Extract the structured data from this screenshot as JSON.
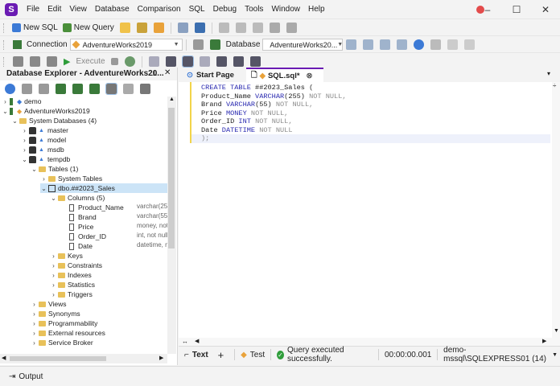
{
  "menu": [
    "File",
    "Edit",
    "View",
    "Database",
    "Comparison",
    "SQL",
    "Debug",
    "Tools",
    "Window",
    "Help"
  ],
  "app_logo": "S",
  "window_controls": {
    "minimize": "–",
    "maximize": "☐",
    "close": "✕"
  },
  "toolbar1": {
    "new_sql": "New SQL",
    "new_query": "New Query"
  },
  "toolbar2": {
    "connection_label": "Connection",
    "connection_value": "AdventureWorks2019",
    "database_label": "Database",
    "database_value": "AdventureWorks20..."
  },
  "toolbar3": {
    "execute": "Execute"
  },
  "explorer": {
    "title": "Database Explorer - AdventureWorks20...",
    "tree": [
      {
        "label": "demo",
        "depth": 0,
        "arrow": "›",
        "icon": "server-icon"
      },
      {
        "label": "AdventureWorks2019",
        "depth": 0,
        "arrow": "⌄",
        "icon": "server-icon"
      },
      {
        "label": "System Databases (4)",
        "depth": 1,
        "arrow": "⌄",
        "icon": "folder-icon"
      },
      {
        "label": "master",
        "depth": 2,
        "arrow": "›",
        "icon": "database-icon"
      },
      {
        "label": "model",
        "depth": 2,
        "arrow": "›",
        "icon": "database-icon"
      },
      {
        "label": "msdb",
        "depth": 2,
        "arrow": "›",
        "icon": "database-icon"
      },
      {
        "label": "tempdb",
        "depth": 2,
        "arrow": "⌄",
        "icon": "database-icon"
      },
      {
        "label": "Tables (1)",
        "depth": 3,
        "arrow": "⌄",
        "icon": "folder-icon"
      },
      {
        "label": "System Tables",
        "depth": 4,
        "arrow": "›",
        "icon": "folder-icon"
      },
      {
        "label": "dbo.##2023_Sales",
        "depth": 4,
        "arrow": "⌄",
        "icon": "table-icon",
        "selected": true
      },
      {
        "label": "Columns (5)",
        "depth": 5,
        "arrow": "⌄",
        "icon": "folder-icon"
      },
      {
        "label": "Product_Name",
        "depth": 6,
        "arrow": "",
        "icon": "column-icon",
        "type": "varchar(25"
      },
      {
        "label": "Brand",
        "depth": 6,
        "arrow": "",
        "icon": "column-icon",
        "type": "varchar(55"
      },
      {
        "label": "Price",
        "depth": 6,
        "arrow": "",
        "icon": "column-icon",
        "type": "money, not"
      },
      {
        "label": "Order_ID",
        "depth": 6,
        "arrow": "",
        "icon": "column-icon",
        "type": "int, not null"
      },
      {
        "label": "Date",
        "depth": 6,
        "arrow": "",
        "icon": "column-icon",
        "type": "datetime, n"
      },
      {
        "label": "Keys",
        "depth": 5,
        "arrow": "›",
        "icon": "folder-icon"
      },
      {
        "label": "Constraints",
        "depth": 5,
        "arrow": "›",
        "icon": "folder-icon"
      },
      {
        "label": "Indexes",
        "depth": 5,
        "arrow": "›",
        "icon": "folder-icon"
      },
      {
        "label": "Statistics",
        "depth": 5,
        "arrow": "›",
        "icon": "folder-icon"
      },
      {
        "label": "Triggers",
        "depth": 5,
        "arrow": "›",
        "icon": "folder-icon"
      },
      {
        "label": "Views",
        "depth": 3,
        "arrow": "›",
        "icon": "folder-icon"
      },
      {
        "label": "Synonyms",
        "depth": 3,
        "arrow": "›",
        "icon": "folder-icon"
      },
      {
        "label": "Programmability",
        "depth": 3,
        "arrow": "›",
        "icon": "folder-icon"
      },
      {
        "label": "External resources",
        "depth": 3,
        "arrow": "›",
        "icon": "folder-icon"
      },
      {
        "label": "Service Broker",
        "depth": 3,
        "arrow": "›",
        "icon": "folder-icon"
      }
    ]
  },
  "tabs": {
    "start_page": "Start Page",
    "sql_tab": "SQL.sql*"
  },
  "editor": {
    "lines": [
      [
        {
          "t": "CREATE TABLE ",
          "c": "kw"
        },
        {
          "t": "##2023_Sales (",
          "c": "fn"
        }
      ],
      [
        {
          "t": "Product_Name ",
          "c": "fn"
        },
        {
          "t": "VARCHAR",
          "c": "ty"
        },
        {
          "t": "(255) ",
          "c": "fn"
        },
        {
          "t": "NOT NULL,",
          "c": "mu"
        }
      ],
      [
        {
          "t": "Brand ",
          "c": "fn"
        },
        {
          "t": "VARCHAR",
          "c": "ty"
        },
        {
          "t": "(55) ",
          "c": "fn"
        },
        {
          "t": "NOT NULL,",
          "c": "mu"
        }
      ],
      [
        {
          "t": "Price ",
          "c": "fn"
        },
        {
          "t": "MONEY ",
          "c": "ty"
        },
        {
          "t": "NOT NULL,",
          "c": "mu"
        }
      ],
      [
        {
          "t": "Order_ID ",
          "c": "fn"
        },
        {
          "t": "INT ",
          "c": "ty"
        },
        {
          "t": "NOT NULL,",
          "c": "mu"
        }
      ],
      [
        {
          "t": "Date ",
          "c": "fn"
        },
        {
          "t": "DATETIME ",
          "c": "ty"
        },
        {
          "t": "NOT NULL",
          "c": "mu"
        }
      ],
      [
        {
          "t": ");",
          "c": "mu"
        }
      ]
    ]
  },
  "statusbar": {
    "text_tab": "Text",
    "add": "+",
    "test": "Test",
    "message": "Query executed successfully.",
    "elapsed": "00:00:00.001",
    "connection": "demo-mssql\\SQLEXPRESS01 (14)"
  },
  "output": {
    "label": "Output"
  },
  "colors": {
    "accent": "#6a1bb3",
    "success": "#2e9d3a",
    "keyword": "#2a2ab0",
    "muted": "#8c8c8c",
    "selection": "#cce4f7"
  }
}
